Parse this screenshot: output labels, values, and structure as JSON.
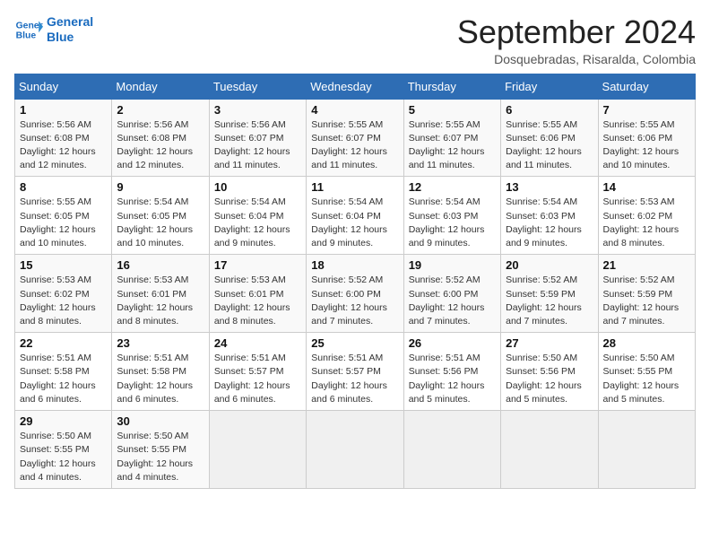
{
  "header": {
    "logo_line1": "General",
    "logo_line2": "Blue",
    "month": "September 2024",
    "location": "Dosquebradas, Risaralda, Colombia"
  },
  "days_of_week": [
    "Sunday",
    "Monday",
    "Tuesday",
    "Wednesday",
    "Thursday",
    "Friday",
    "Saturday"
  ],
  "weeks": [
    [
      {
        "day": 1,
        "info": "Sunrise: 5:56 AM\nSunset: 6:08 PM\nDaylight: 12 hours\nand 12 minutes."
      },
      {
        "day": 2,
        "info": "Sunrise: 5:56 AM\nSunset: 6:08 PM\nDaylight: 12 hours\nand 12 minutes."
      },
      {
        "day": 3,
        "info": "Sunrise: 5:56 AM\nSunset: 6:07 PM\nDaylight: 12 hours\nand 11 minutes."
      },
      {
        "day": 4,
        "info": "Sunrise: 5:55 AM\nSunset: 6:07 PM\nDaylight: 12 hours\nand 11 minutes."
      },
      {
        "day": 5,
        "info": "Sunrise: 5:55 AM\nSunset: 6:07 PM\nDaylight: 12 hours\nand 11 minutes."
      },
      {
        "day": 6,
        "info": "Sunrise: 5:55 AM\nSunset: 6:06 PM\nDaylight: 12 hours\nand 11 minutes."
      },
      {
        "day": 7,
        "info": "Sunrise: 5:55 AM\nSunset: 6:06 PM\nDaylight: 12 hours\nand 10 minutes."
      }
    ],
    [
      {
        "day": 8,
        "info": "Sunrise: 5:55 AM\nSunset: 6:05 PM\nDaylight: 12 hours\nand 10 minutes."
      },
      {
        "day": 9,
        "info": "Sunrise: 5:54 AM\nSunset: 6:05 PM\nDaylight: 12 hours\nand 10 minutes."
      },
      {
        "day": 10,
        "info": "Sunrise: 5:54 AM\nSunset: 6:04 PM\nDaylight: 12 hours\nand 9 minutes."
      },
      {
        "day": 11,
        "info": "Sunrise: 5:54 AM\nSunset: 6:04 PM\nDaylight: 12 hours\nand 9 minutes."
      },
      {
        "day": 12,
        "info": "Sunrise: 5:54 AM\nSunset: 6:03 PM\nDaylight: 12 hours\nand 9 minutes."
      },
      {
        "day": 13,
        "info": "Sunrise: 5:54 AM\nSunset: 6:03 PM\nDaylight: 12 hours\nand 9 minutes."
      },
      {
        "day": 14,
        "info": "Sunrise: 5:53 AM\nSunset: 6:02 PM\nDaylight: 12 hours\nand 8 minutes."
      }
    ],
    [
      {
        "day": 15,
        "info": "Sunrise: 5:53 AM\nSunset: 6:02 PM\nDaylight: 12 hours\nand 8 minutes."
      },
      {
        "day": 16,
        "info": "Sunrise: 5:53 AM\nSunset: 6:01 PM\nDaylight: 12 hours\nand 8 minutes."
      },
      {
        "day": 17,
        "info": "Sunrise: 5:53 AM\nSunset: 6:01 PM\nDaylight: 12 hours\nand 8 minutes."
      },
      {
        "day": 18,
        "info": "Sunrise: 5:52 AM\nSunset: 6:00 PM\nDaylight: 12 hours\nand 7 minutes."
      },
      {
        "day": 19,
        "info": "Sunrise: 5:52 AM\nSunset: 6:00 PM\nDaylight: 12 hours\nand 7 minutes."
      },
      {
        "day": 20,
        "info": "Sunrise: 5:52 AM\nSunset: 5:59 PM\nDaylight: 12 hours\nand 7 minutes."
      },
      {
        "day": 21,
        "info": "Sunrise: 5:52 AM\nSunset: 5:59 PM\nDaylight: 12 hours\nand 7 minutes."
      }
    ],
    [
      {
        "day": 22,
        "info": "Sunrise: 5:51 AM\nSunset: 5:58 PM\nDaylight: 12 hours\nand 6 minutes."
      },
      {
        "day": 23,
        "info": "Sunrise: 5:51 AM\nSunset: 5:58 PM\nDaylight: 12 hours\nand 6 minutes."
      },
      {
        "day": 24,
        "info": "Sunrise: 5:51 AM\nSunset: 5:57 PM\nDaylight: 12 hours\nand 6 minutes."
      },
      {
        "day": 25,
        "info": "Sunrise: 5:51 AM\nSunset: 5:57 PM\nDaylight: 12 hours\nand 6 minutes."
      },
      {
        "day": 26,
        "info": "Sunrise: 5:51 AM\nSunset: 5:56 PM\nDaylight: 12 hours\nand 5 minutes."
      },
      {
        "day": 27,
        "info": "Sunrise: 5:50 AM\nSunset: 5:56 PM\nDaylight: 12 hours\nand 5 minutes."
      },
      {
        "day": 28,
        "info": "Sunrise: 5:50 AM\nSunset: 5:55 PM\nDaylight: 12 hours\nand 5 minutes."
      }
    ],
    [
      {
        "day": 29,
        "info": "Sunrise: 5:50 AM\nSunset: 5:55 PM\nDaylight: 12 hours\nand 4 minutes."
      },
      {
        "day": 30,
        "info": "Sunrise: 5:50 AM\nSunset: 5:55 PM\nDaylight: 12 hours\nand 4 minutes."
      },
      {
        "day": null,
        "info": ""
      },
      {
        "day": null,
        "info": ""
      },
      {
        "day": null,
        "info": ""
      },
      {
        "day": null,
        "info": ""
      },
      {
        "day": null,
        "info": ""
      }
    ]
  ]
}
